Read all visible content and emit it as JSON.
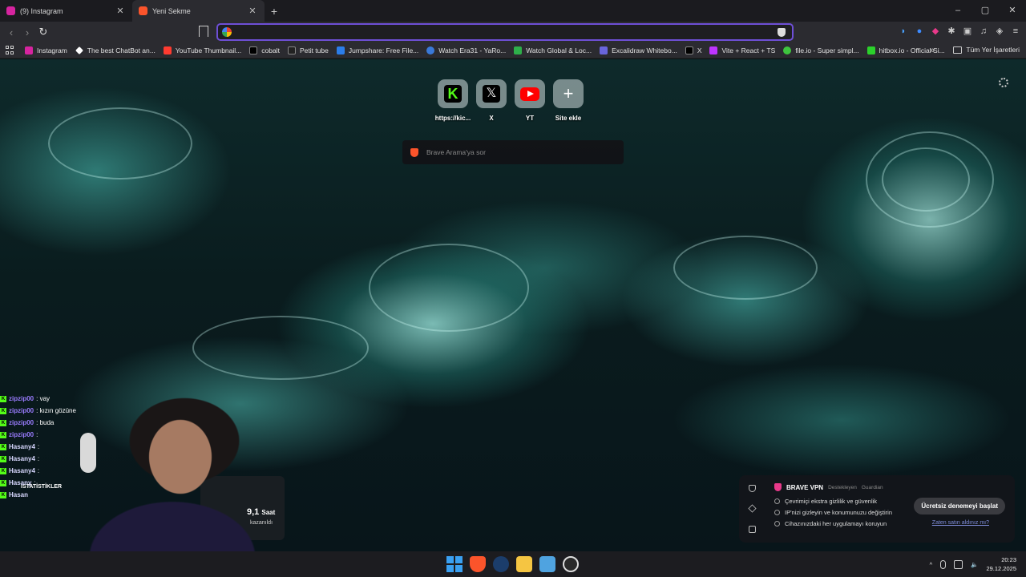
{
  "tabs": [
    {
      "title": "(9) Instagram",
      "active": false,
      "favicon_color": "#d6249f"
    },
    {
      "title": "Yeni Sekme",
      "active": true,
      "favicon_color": "#fb542b"
    }
  ],
  "new_tab_label": "+",
  "window_controls": {
    "minimize": "–",
    "maximize": "▢",
    "close": "✕"
  },
  "toolbar": {
    "back": "‹",
    "forward": "›",
    "reload": "↻",
    "url_value": ""
  },
  "bookmarks": [
    {
      "label": "Instagram",
      "color": "#d6249f"
    },
    {
      "label": "The best ChatBot an...",
      "color": "#ffffff"
    },
    {
      "label": "YouTube Thumbnail...",
      "color": "#ff3b30"
    },
    {
      "label": "cobalt",
      "color": "#000000"
    },
    {
      "label": "Petit tube",
      "color": "#222222"
    },
    {
      "label": "Jumpshare: Free File...",
      "color": "#2b7de9"
    },
    {
      "label": "Watch Era31 - YaRo...",
      "color": "#3a79d8"
    },
    {
      "label": "Watch Global & Loc...",
      "color": "#2eaf4a"
    },
    {
      "label": "Excalidraw Whitebo...",
      "color": "#6965db"
    },
    {
      "label": "X",
      "color": "#000000"
    },
    {
      "label": "Vite + React + TS",
      "color": "#bd34fe"
    },
    {
      "label": "file.io - Super simpl...",
      "color": "#3ec43e"
    },
    {
      "label": "hitbox.io - Official Si...",
      "color": "#2bd12b"
    }
  ],
  "bookmarks_more": "»",
  "all_bookmarks_label": "Tüm Yer İşaretleri",
  "top_sites": [
    {
      "label": "https://kic...",
      "icon": "kick-icon"
    },
    {
      "label": "X",
      "icon": "x-icon"
    },
    {
      "label": "YT",
      "icon": "youtube-icon"
    },
    {
      "label": "Site ekle",
      "icon": "plus-icon"
    }
  ],
  "search": {
    "placeholder": "Brave Arama'ya sor"
  },
  "vpn": {
    "title": "BRAVE VPN",
    "subtitle": "Destekleyen",
    "partner": "Guardian",
    "features": [
      "Çevrimiçi ekstra gizlilik ve güvenlik",
      "IP'nizi gizleyin ve konumunuzu değiştirin",
      "Cihazınızdaki her uygulamayı koruyun"
    ],
    "cta": "Ücretsiz denemeyi başlat",
    "link": "Zaten satın aldınız mı?"
  },
  "stream": {
    "stat_label": "İSTATİSTİKLER",
    "stat_value": "9,1",
    "stat_unit": "Saat",
    "stat_sub": "kazanıldı",
    "chat": [
      {
        "user": "zipzip00",
        "msg": ": vay"
      },
      {
        "user": "zipzip00",
        "msg": ": kızın gözüne"
      },
      {
        "user": "zipzip00",
        "msg": ": buda"
      },
      {
        "user": "zipzip00",
        "msg": ":"
      },
      {
        "user": "Hasany4",
        "msg": ":"
      },
      {
        "user": "Hasany4",
        "msg": ":"
      },
      {
        "user": "Hasany4",
        "msg": ":"
      },
      {
        "user": "Hasany",
        "msg": ":"
      },
      {
        "user": "Hasan",
        "msg": ""
      }
    ]
  },
  "taskbar": {
    "time": "20:23",
    "date": "29.12.2025"
  }
}
